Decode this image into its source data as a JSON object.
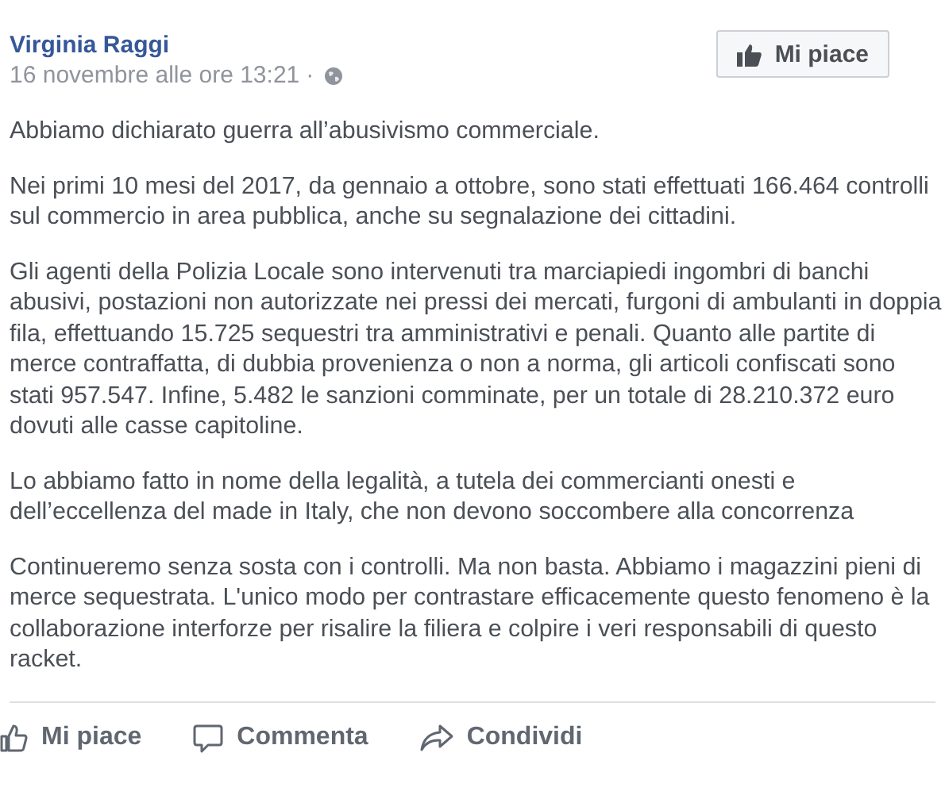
{
  "post": {
    "author": "Virginia Raggi",
    "timestamp": "16 novembre alle ore 13:21",
    "separator": "·",
    "like_button": {
      "label": "Mi piace",
      "selected": false
    },
    "paragraphs": [
      "Abbiamo dichiarato guerra all’abusivismo commerciale.",
      "Nei primi 10 mesi del 2017, da gennaio a ottobre, sono stati effettuati 166.464 controlli sul commercio in area pubblica, anche su segnalazione dei cittadini.",
      "Gli agenti della Polizia Locale sono intervenuti tra marciapiedi ingombri di banchi abusivi, postazioni non autorizzate nei pressi dei mercati, furgoni di ambulanti in doppia fila, effettuando 15.725 sequestri tra amministrativi e penali. Quanto alle partite di merce contraffatta, di dubbia provenienza o non a norma, gli articoli confiscati sono stati 957.547. Infine, 5.482 le sanzioni comminate, per un totale di 28.210.372 euro dovuti alle casse capitoline.",
      "Lo abbiamo fatto in nome della legalità, a tutela dei commercianti onesti e dell’eccellenza del made in Italy, che non devono soccombere alla concorrenza",
      "Continueremo senza sosta con i controlli. Ma non basta. Abbiamo i magazzini pieni di merce sequestrata. L'unico modo per contrastare efficacemente questo fenomeno è la collaborazione interforze per risalire la filiera e colpire i veri responsabili di questo racket."
    ],
    "actions": [
      {
        "kind": "like",
        "label": "Mi piace"
      },
      {
        "kind": "comment",
        "label": "Commenta"
      },
      {
        "kind": "share",
        "label": "Condividi"
      }
    ]
  }
}
